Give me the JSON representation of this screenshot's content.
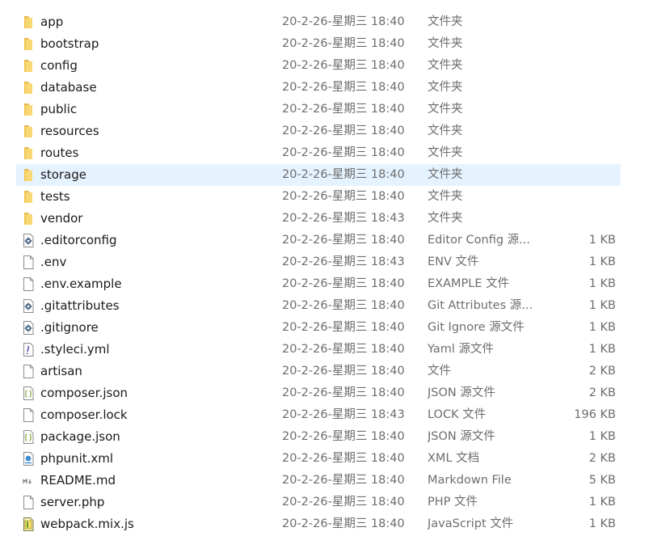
{
  "files": [
    {
      "name": "app",
      "date": "20-2-26-星期三 18:40",
      "type": "文件夹",
      "size": "",
      "icon": "folder-icon"
    },
    {
      "name": "bootstrap",
      "date": "20-2-26-星期三 18:40",
      "type": "文件夹",
      "size": "",
      "icon": "folder-icon"
    },
    {
      "name": "config",
      "date": "20-2-26-星期三 18:40",
      "type": "文件夹",
      "size": "",
      "icon": "folder-icon"
    },
    {
      "name": "database",
      "date": "20-2-26-星期三 18:40",
      "type": "文件夹",
      "size": "",
      "icon": "folder-icon"
    },
    {
      "name": "public",
      "date": "20-2-26-星期三 18:40",
      "type": "文件夹",
      "size": "",
      "icon": "folder-icon"
    },
    {
      "name": "resources",
      "date": "20-2-26-星期三 18:40",
      "type": "文件夹",
      "size": "",
      "icon": "folder-icon"
    },
    {
      "name": "routes",
      "date": "20-2-26-星期三 18:40",
      "type": "文件夹",
      "size": "",
      "icon": "folder-icon"
    },
    {
      "name": "storage",
      "date": "20-2-26-星期三 18:40",
      "type": "文件夹",
      "size": "",
      "icon": "folder-icon",
      "selected": true
    },
    {
      "name": "tests",
      "date": "20-2-26-星期三 18:40",
      "type": "文件夹",
      "size": "",
      "icon": "folder-icon"
    },
    {
      "name": "vendor",
      "date": "20-2-26-星期三 18:43",
      "type": "文件夹",
      "size": "",
      "icon": "folder-icon"
    },
    {
      "name": ".editorconfig",
      "date": "20-2-26-星期三 18:40",
      "type": "Editor Config 源...",
      "size": "1 KB",
      "icon": "settings-file-icon"
    },
    {
      "name": ".env",
      "date": "20-2-26-星期三 18:43",
      "type": "ENV 文件",
      "size": "1 KB",
      "icon": "blank-file-icon"
    },
    {
      "name": ".env.example",
      "date": "20-2-26-星期三 18:40",
      "type": "EXAMPLE 文件",
      "size": "1 KB",
      "icon": "blank-file-icon"
    },
    {
      "name": ".gitattributes",
      "date": "20-2-26-星期三 18:40",
      "type": "Git Attributes 源...",
      "size": "1 KB",
      "icon": "settings-file-icon"
    },
    {
      "name": ".gitignore",
      "date": "20-2-26-星期三 18:40",
      "type": "Git Ignore 源文件",
      "size": "1 KB",
      "icon": "settings-file-icon"
    },
    {
      "name": ".styleci.yml",
      "date": "20-2-26-星期三 18:40",
      "type": "Yaml 源文件",
      "size": "1 KB",
      "icon": "yaml-file-icon"
    },
    {
      "name": "artisan",
      "date": "20-2-26-星期三 18:40",
      "type": "文件",
      "size": "2 KB",
      "icon": "blank-file-icon"
    },
    {
      "name": "composer.json",
      "date": "20-2-26-星期三 18:40",
      "type": "JSON 源文件",
      "size": "2 KB",
      "icon": "json-file-icon"
    },
    {
      "name": "composer.lock",
      "date": "20-2-26-星期三 18:43",
      "type": "LOCK 文件",
      "size": "196 KB",
      "icon": "blank-file-icon"
    },
    {
      "name": "package.json",
      "date": "20-2-26-星期三 18:40",
      "type": "JSON 源文件",
      "size": "1 KB",
      "icon": "json-file-icon"
    },
    {
      "name": "phpunit.xml",
      "date": "20-2-26-星期三 18:40",
      "type": "XML 文档",
      "size": "2 KB",
      "icon": "xml-file-icon"
    },
    {
      "name": "README.md",
      "date": "20-2-26-星期三 18:40",
      "type": "Markdown File",
      "size": "5 KB",
      "icon": "markdown-file-icon"
    },
    {
      "name": "server.php",
      "date": "20-2-26-星期三 18:40",
      "type": "PHP 文件",
      "size": "1 KB",
      "icon": "blank-file-icon"
    },
    {
      "name": "webpack.mix.js",
      "date": "20-2-26-星期三 18:40",
      "type": "JavaScript 文件",
      "size": "1 KB",
      "icon": "javascript-file-icon"
    }
  ],
  "colors": {
    "folder": "#f8d775",
    "folder_dark": "#e8b84a",
    "selection": "#e5f3ff",
    "secondary_text": "#6d6d6d"
  }
}
